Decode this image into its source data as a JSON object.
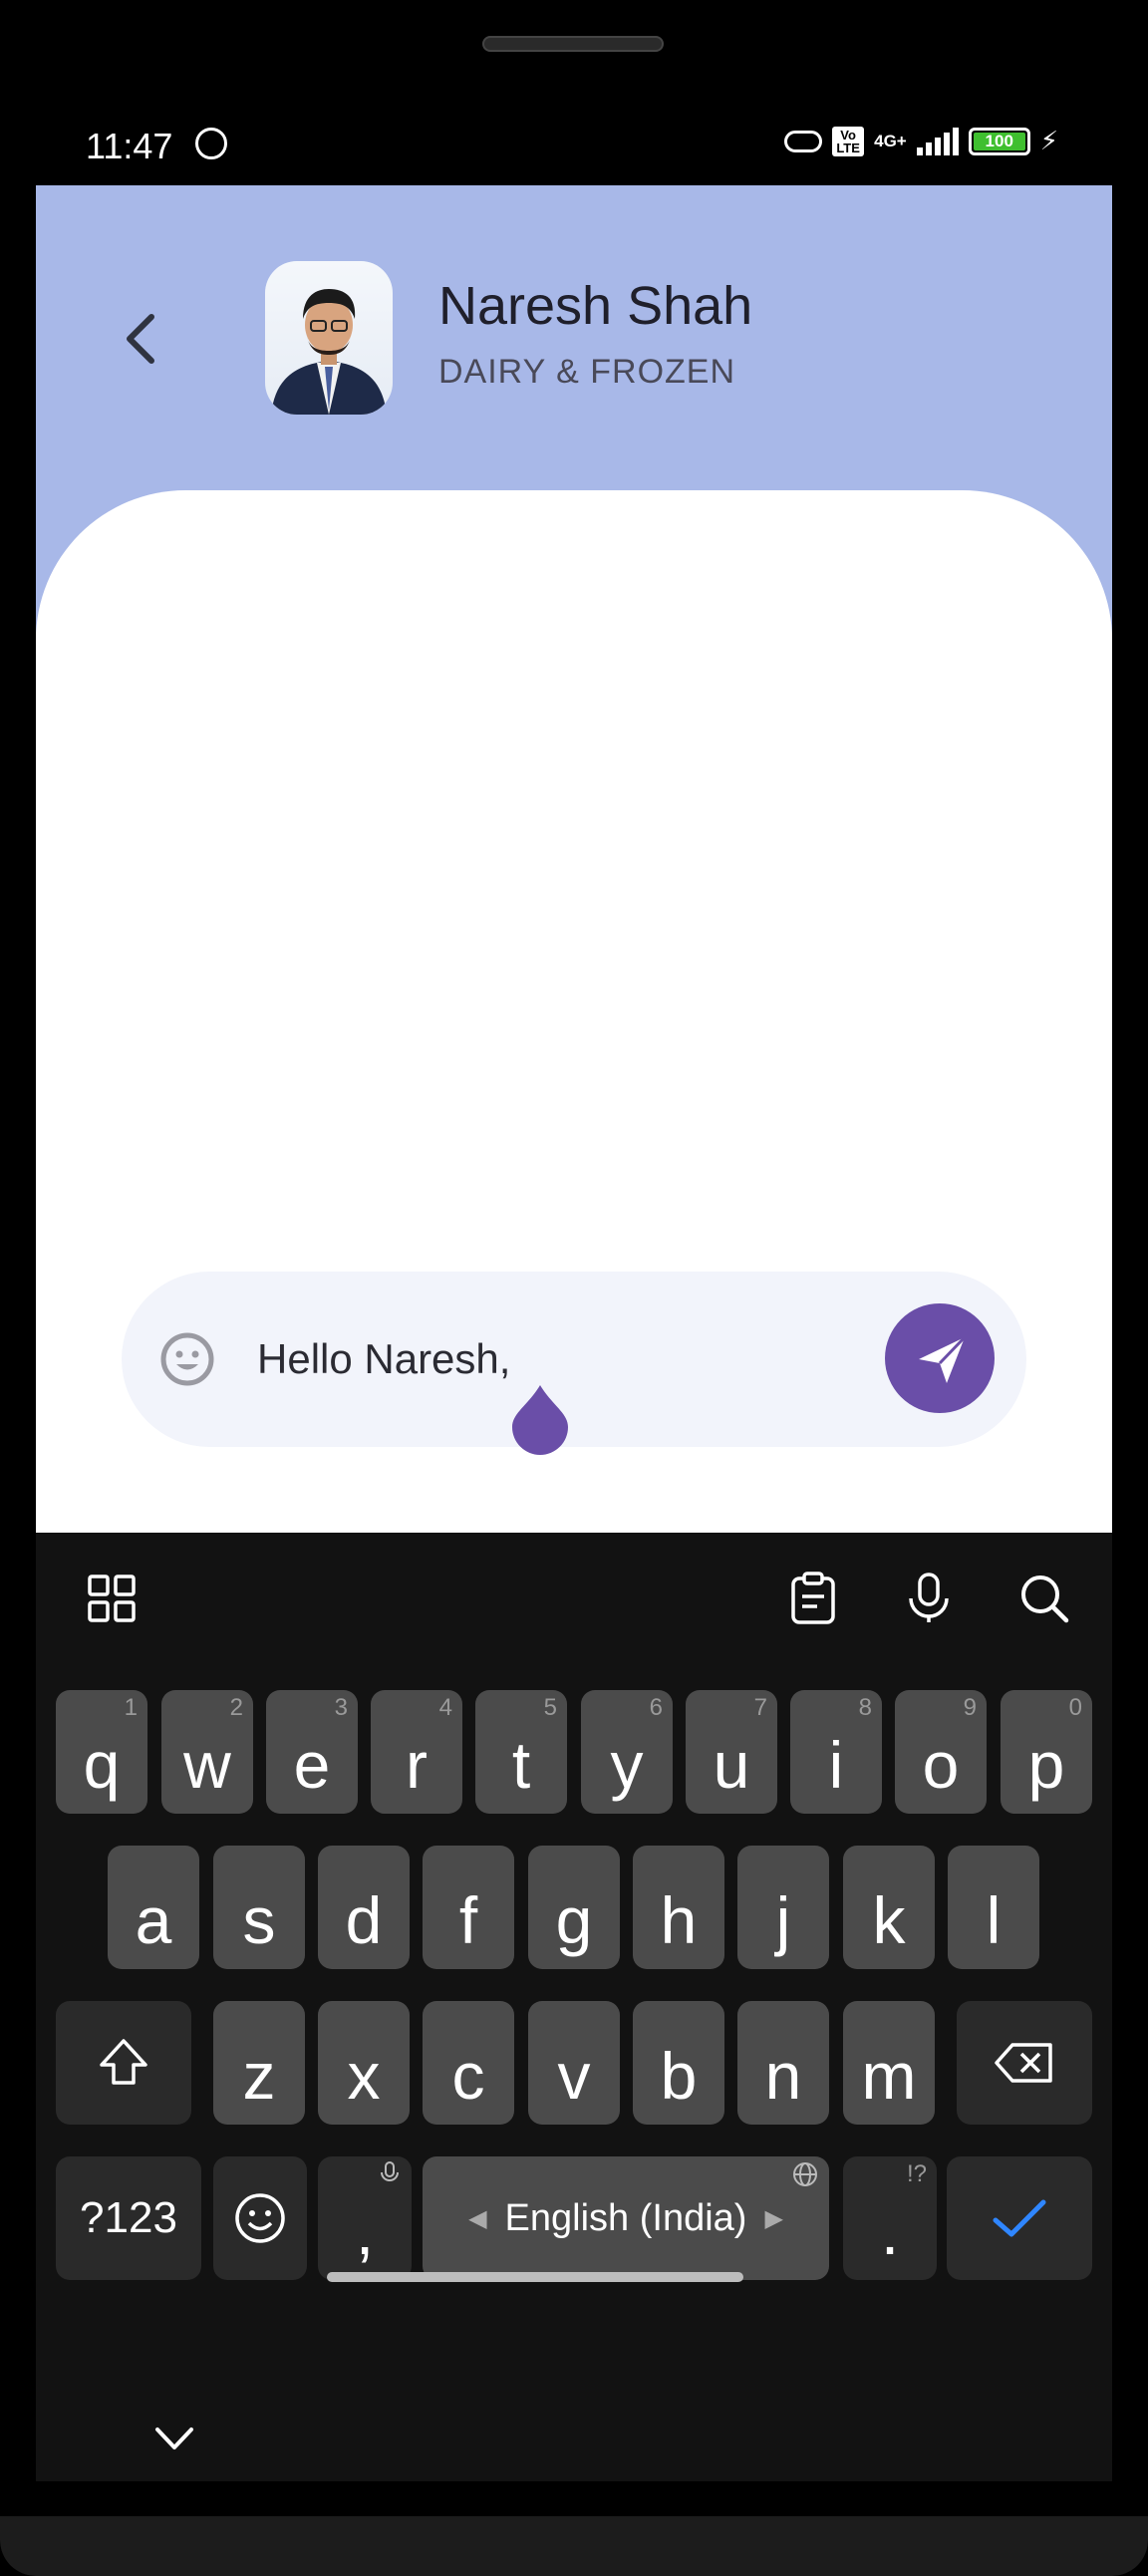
{
  "status_bar": {
    "time": "11:47",
    "network_type": "4G+",
    "volte_badge": "Vo LTE",
    "battery_level": "100",
    "battery_percent": 100
  },
  "header": {
    "contact_name": "Naresh Shah",
    "contact_department": "DAIRY & FROZEN",
    "back_icon": "chevron-left-icon",
    "background_color": "#a8b8e8"
  },
  "composer": {
    "message_value": "Hello Naresh,",
    "emoji_icon": "smiley-icon",
    "send_icon": "paper-plane-icon",
    "send_color": "#6a4ea8"
  },
  "keyboard": {
    "toolbar": [
      "grid-icon",
      "clipboard-icon",
      "microphone-icon",
      "search-icon"
    ],
    "row1": [
      {
        "key": "q",
        "hint": "1"
      },
      {
        "key": "w",
        "hint": "2"
      },
      {
        "key": "e",
        "hint": "3"
      },
      {
        "key": "r",
        "hint": "4"
      },
      {
        "key": "t",
        "hint": "5"
      },
      {
        "key": "y",
        "hint": "6"
      },
      {
        "key": "u",
        "hint": "7"
      },
      {
        "key": "i",
        "hint": "8"
      },
      {
        "key": "o",
        "hint": "9"
      },
      {
        "key": "p",
        "hint": "0"
      }
    ],
    "row2": [
      "a",
      "s",
      "d",
      "f",
      "g",
      "h",
      "j",
      "k",
      "l"
    ],
    "row3": [
      "z",
      "x",
      "c",
      "v",
      "b",
      "n",
      "m"
    ],
    "symbols_key": "?123",
    "comma_key": ",",
    "space_label": "English (India)",
    "period_key": ".",
    "period_hint": "!?",
    "enter_icon": "checkmark-icon"
  }
}
